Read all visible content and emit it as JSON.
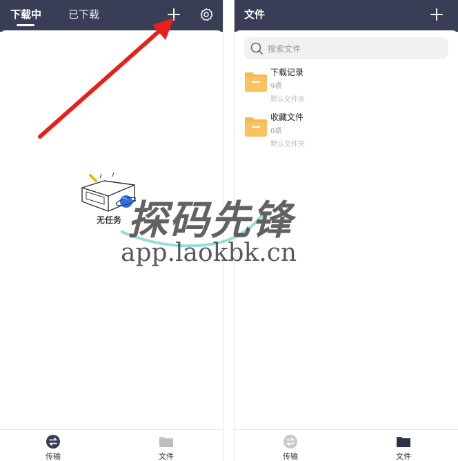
{
  "left": {
    "tabs": [
      {
        "label": "下载中",
        "active": true
      },
      {
        "label": "已下载",
        "active": false
      }
    ],
    "add_icon": "plus-icon",
    "settings_icon": "gear-icon",
    "empty_label": "无任务",
    "bottom_nav": [
      {
        "label": "传输",
        "icon": "transfer-icon",
        "active": true
      },
      {
        "label": "文件",
        "icon": "folder-icon",
        "active": false
      }
    ]
  },
  "right": {
    "title": "文件",
    "add_icon": "plus-icon",
    "search": {
      "placeholder": "搜索文件"
    },
    "folders": [
      {
        "name": "下载记录",
        "count": "9项",
        "sub": "默认文件夹"
      },
      {
        "name": "收藏文件",
        "count": "0项",
        "sub": "默认文件夹"
      }
    ],
    "bottom_nav": [
      {
        "label": "传输",
        "icon": "transfer-icon",
        "active": false
      },
      {
        "label": "文件",
        "icon": "folder-icon",
        "active": true
      }
    ]
  },
  "watermark": {
    "text": "探码先锋",
    "url": "app.laokbk.cn"
  },
  "colors": {
    "header": "#3a3d56",
    "folder": "#f7b84e",
    "annotation_arrow": "#e8201a",
    "accent_blue": "#2f6fe0"
  }
}
